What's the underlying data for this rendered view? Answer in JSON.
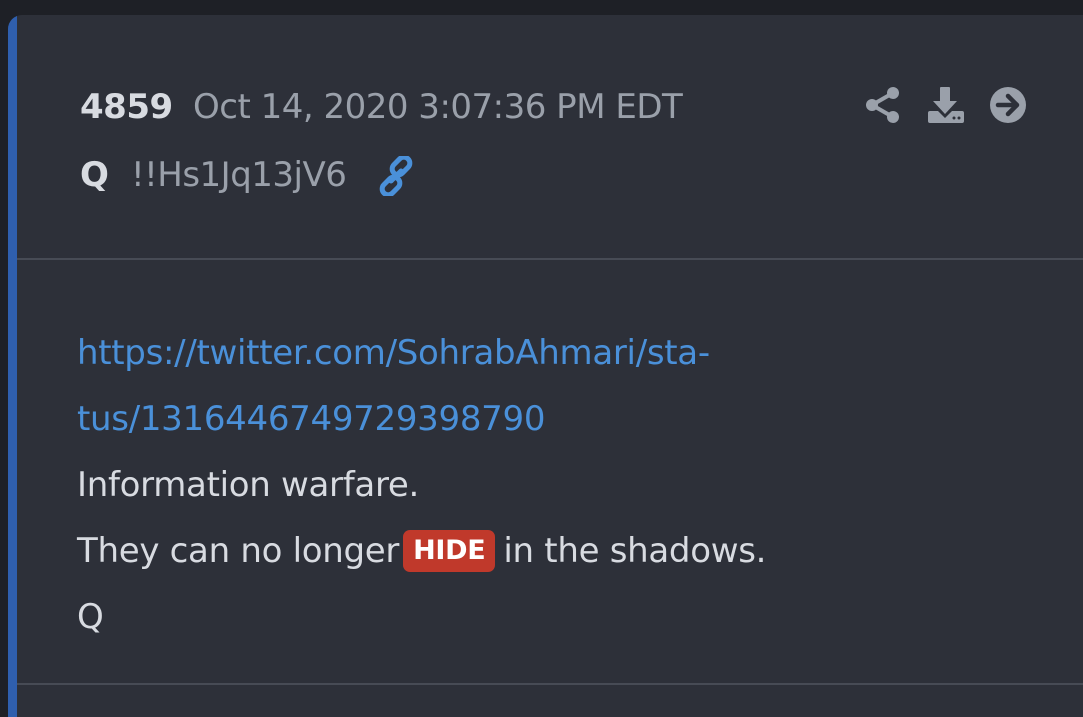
{
  "post": {
    "number": "4859",
    "timestamp": "Oct 14, 2020 3:07:36 PM EDT",
    "author": "Q",
    "tripcode": "!!Hs1Jq13jV6"
  },
  "actions": [
    {
      "name": "share",
      "icon": "share-icon"
    },
    {
      "name": "download",
      "icon": "download-icon"
    },
    {
      "name": "next",
      "icon": "arrow-right-circle-icon"
    }
  ],
  "body": {
    "link_line1": "https://twitter.com/SohrabAhmari/sta-",
    "link_line2": "tus/1316446749729398790",
    "line1": "Information warfare.",
    "line2_before": "They can no longer",
    "badge": "HIDE",
    "line2_after": "in the shadows.",
    "signature": "Q"
  },
  "colors": {
    "page_background": "#1e2026",
    "card_background": "#2d3039",
    "accent_bar": "#2f5fae",
    "link": "#4a90d9",
    "badge": "#c0392b",
    "primary_text": "#d8dbe1",
    "secondary_text": "#9aa0aa"
  }
}
